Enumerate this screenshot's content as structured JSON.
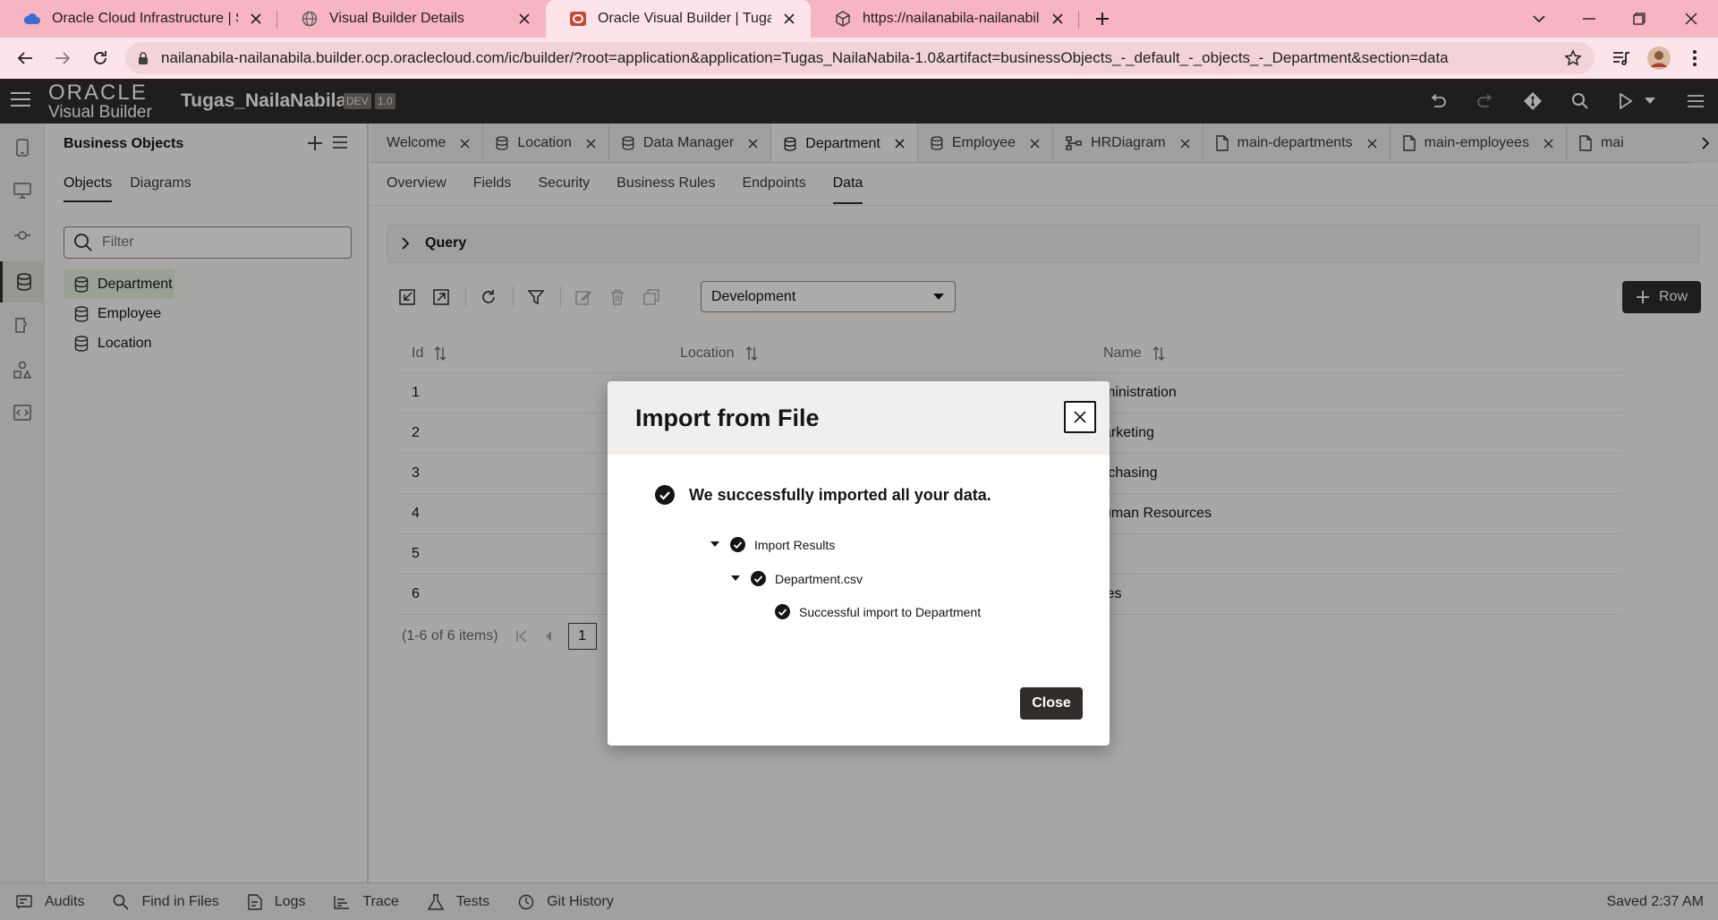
{
  "browser": {
    "tabs": [
      {
        "label": "Oracle Cloud Infrastructure | Sign",
        "icon": "cloud-icon"
      },
      {
        "label": "Visual Builder Details",
        "icon": "globe-icon"
      },
      {
        "label": "Oracle Visual Builder | Tugas_Nai",
        "icon": "oracle-icon"
      },
      {
        "label": "https://nailanabila-nailanabila.bu",
        "icon": "cube-icon"
      }
    ],
    "url": "nailanabila-nailanabila.builder.ocp.oraclecloud.com/ic/builder/?root=application&application=Tugas_NailaNabila-1.0&artifact=businessObjects_-_default_-_objects_-_Department&section=data"
  },
  "app": {
    "logo_top": "ORACLE",
    "logo_bottom": "Visual Builder",
    "title": "Tugas_NailaNabila",
    "badge_env": "DEV",
    "badge_version": "1.0"
  },
  "navigator": {
    "title": "Business Objects",
    "tabs": [
      "Objects",
      "Diagrams"
    ],
    "filter_placeholder": "Filter",
    "objects": [
      "Department",
      "Employee",
      "Location"
    ]
  },
  "editor_tabs": [
    {
      "label": "Welcome",
      "icon": "none"
    },
    {
      "label": "Location",
      "icon": "database-icon"
    },
    {
      "label": "Data Manager",
      "icon": "database-icon"
    },
    {
      "label": "Department",
      "icon": "database-icon"
    },
    {
      "label": "Employee",
      "icon": "database-icon"
    },
    {
      "label": "HRDiagram",
      "icon": "diagram-icon"
    },
    {
      "label": "main-departments",
      "icon": "page-icon"
    },
    {
      "label": "main-employees",
      "icon": "page-icon"
    },
    {
      "label": "mai",
      "icon": "page-icon"
    }
  ],
  "subtabs": [
    "Overview",
    "Fields",
    "Security",
    "Business Rules",
    "Endpoints",
    "Data"
  ],
  "query_label": "Query",
  "environment": "Development",
  "row_button": "Row",
  "table": {
    "headers": [
      "Id",
      "Location",
      "Name"
    ],
    "rows": [
      [
        "1",
        "",
        "ministration"
      ],
      [
        "2",
        "",
        "arketing"
      ],
      [
        "3",
        "",
        "rchasing"
      ],
      [
        "4",
        "",
        "uman Resources"
      ],
      [
        "5",
        "",
        ""
      ],
      [
        "6",
        "",
        "les"
      ]
    ]
  },
  "pager": {
    "summary": "(1-6 of 6 items)",
    "page": "1"
  },
  "statusbar": {
    "items": [
      "Audits",
      "Find in Files",
      "Logs",
      "Trace",
      "Tests",
      "Git History"
    ],
    "saved": "Saved 2:37 AM"
  },
  "dialog": {
    "title": "Import from File",
    "message": "We successfully imported all your data.",
    "tree": [
      "Import Results",
      "Department.csv",
      "Successful import to Department"
    ],
    "close_label": "Close"
  },
  "colors": {
    "accent_dark": "#312d2a",
    "browser_tabstrip": "#f7b5c2",
    "browser_active": "#fde4ea"
  }
}
